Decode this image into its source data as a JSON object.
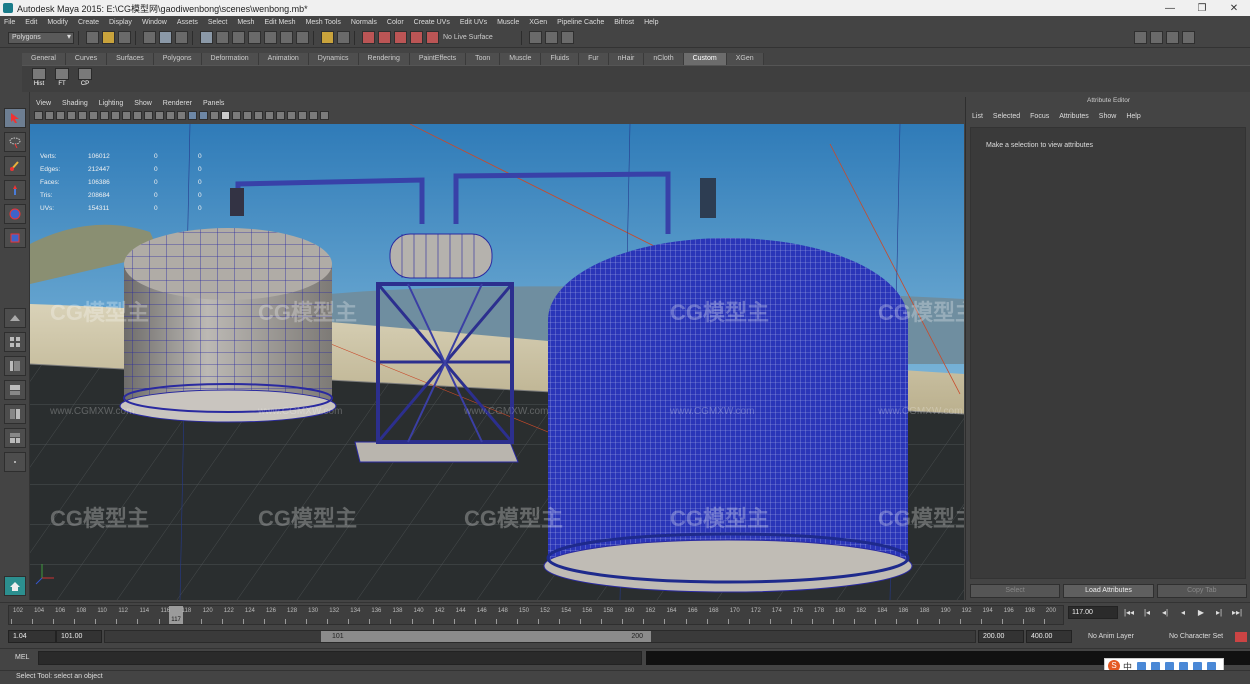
{
  "window": {
    "title": "Autodesk Maya 2015: E:\\CG模型网\\gaodiwenbong\\scenes\\wenbong.mb*"
  },
  "menus": [
    "File",
    "Edit",
    "Modify",
    "Create",
    "Display",
    "Window",
    "Assets",
    "Select",
    "Mesh",
    "Edit Mesh",
    "Mesh Tools",
    "Normals",
    "Color",
    "Create UVs",
    "Edit UVs",
    "Muscle",
    "XGen",
    "Pipeline Cache",
    "Bifrost",
    "Help"
  ],
  "toolbar": {
    "mode": "Polygons",
    "live_surface": "No Live Surface"
  },
  "shelf": {
    "tabs": [
      "General",
      "Curves",
      "Surfaces",
      "Polygons",
      "Deformation",
      "Animation",
      "Dynamics",
      "Rendering",
      "PaintEffects",
      "Toon",
      "Muscle",
      "Fluids",
      "Fur",
      "nHair",
      "nCloth",
      "Custom",
      "XGen"
    ],
    "active_tab": "Custom",
    "buttons": [
      "Hist",
      "FT",
      "CP"
    ]
  },
  "viewport": {
    "menu": [
      "View",
      "Shading",
      "Lighting",
      "Show",
      "Renderer",
      "Panels"
    ],
    "hud": [
      {
        "label": "Verts:",
        "value": "106012",
        "v2": "0",
        "v3": "0"
      },
      {
        "label": "Edges:",
        "value": "212447",
        "v2": "0",
        "v3": "0"
      },
      {
        "label": "Faces:",
        "value": "106386",
        "v2": "0",
        "v3": "0"
      },
      {
        "label": "Tris:",
        "value": "208684",
        "v2": "0",
        "v3": "0"
      },
      {
        "label": "UVs:",
        "value": "154311",
        "v2": "0",
        "v3": "0"
      }
    ]
  },
  "attribute_editor": {
    "title": "Attribute Editor",
    "menu": [
      "List",
      "Selected",
      "Focus",
      "Attributes",
      "Show",
      "Help"
    ],
    "message": "Make a selection to view attributes",
    "buttons": [
      "Select",
      "Load Attributes",
      "Copy Tab"
    ]
  },
  "timeline": {
    "ticks": [
      "102",
      "104",
      "106",
      "108",
      "110",
      "112",
      "114",
      "116",
      "118",
      "120",
      "122",
      "124",
      "126",
      "128",
      "130",
      "132",
      "134",
      "136",
      "138",
      "140",
      "142",
      "144",
      "146",
      "148",
      "150",
      "152",
      "154",
      "156",
      "158",
      "160",
      "162",
      "164",
      "166",
      "168",
      "170",
      "172",
      "174",
      "176",
      "178",
      "180",
      "182",
      "184",
      "186",
      "188",
      "190",
      "192",
      "194",
      "196",
      "198",
      "200"
    ],
    "current_frame_label": "117",
    "current_frame_field": "117.00",
    "controls": [
      "|◂◂",
      "|◂",
      "◂|",
      "◂",
      "▶",
      "▸|",
      "▸▸|"
    ]
  },
  "range": {
    "start": "1.04",
    "min": "101.00",
    "slider_start": "101",
    "slider_end": "200",
    "max": "200.00",
    "end": "400.00",
    "anim_layer": "No Anim Layer",
    "character_set": "No Character Set"
  },
  "command": {
    "label": "MEL"
  },
  "help": {
    "text": "Select Tool: select an object"
  },
  "ime": {
    "text": "中"
  },
  "watermark": {
    "text": "CG模型主",
    "url": "www.CGMXW.com"
  }
}
